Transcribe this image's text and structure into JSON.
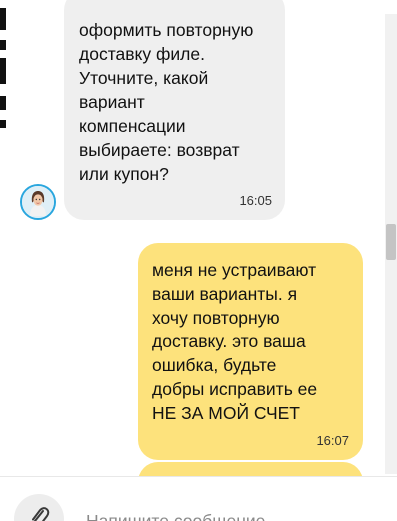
{
  "incoming_message": {
    "text": "оформить повторную\nдоставку филе.\nУточните, какой\nвариант\nкомпенсации\nвыбираете: возврат\nили купон?",
    "time": "16:05"
  },
  "outgoing_message": {
    "text": "меня не устраивают\nваши варианты. я\nхочу повторную\nдоставку. это ваша\nошибка, будьте\nдобры исправить ее\nНЕ ЗА МОЙ СЧЕТ",
    "time": "16:07"
  },
  "composer": {
    "placeholder": "Напишите сообщение",
    "attach_icon": "paperclip-icon"
  },
  "colors": {
    "incoming_bubble": "#efefef",
    "outgoing_bubble": "#fde27c",
    "avatar_ring": "#29a6de"
  }
}
